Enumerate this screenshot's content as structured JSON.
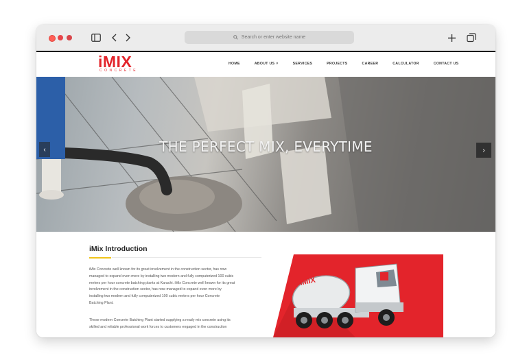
{
  "browser": {
    "address_placeholder": "Search or enter website name"
  },
  "site": {
    "logo_main": "iMIX",
    "logo_sub": "CONCRETE",
    "brand_color": "#e3242b",
    "nav": {
      "items": [
        "HOME",
        "ABOUT US",
        "SERVICES",
        "PROJECTS",
        "CAREER",
        "CALCULATOR",
        "CONTACT US"
      ]
    },
    "hero": {
      "title": "THE PERFECT MIX, EVERYTIME",
      "prev_icon": "chevron-left-icon",
      "next_icon": "chevron-right-icon"
    },
    "intro": {
      "heading": "iMix Introduction",
      "accent_color": "#f0c419",
      "paragraph_1_lines": [
        "iMix Concrete well known for its great involvement in the construction sector, has now",
        "managed to expand even more by installing two modern and fully computerized 100 cubic",
        "meters per hour concrete batching plants at Karachi. iMix Concrete well known for its great",
        "involvement in the construction sector, has now managed to expand even more by",
        "installing two modern and fully computerized 100 cubic meters per hour Concrete",
        "Batching Plant."
      ],
      "paragraph_2_lines": [
        "These modern Concrete Batching Plant started supplying a ready mix concrete using its",
        "skilled and reliable professional work forces to customers engaged in the construction"
      ],
      "truck_label": "iMIX"
    }
  }
}
